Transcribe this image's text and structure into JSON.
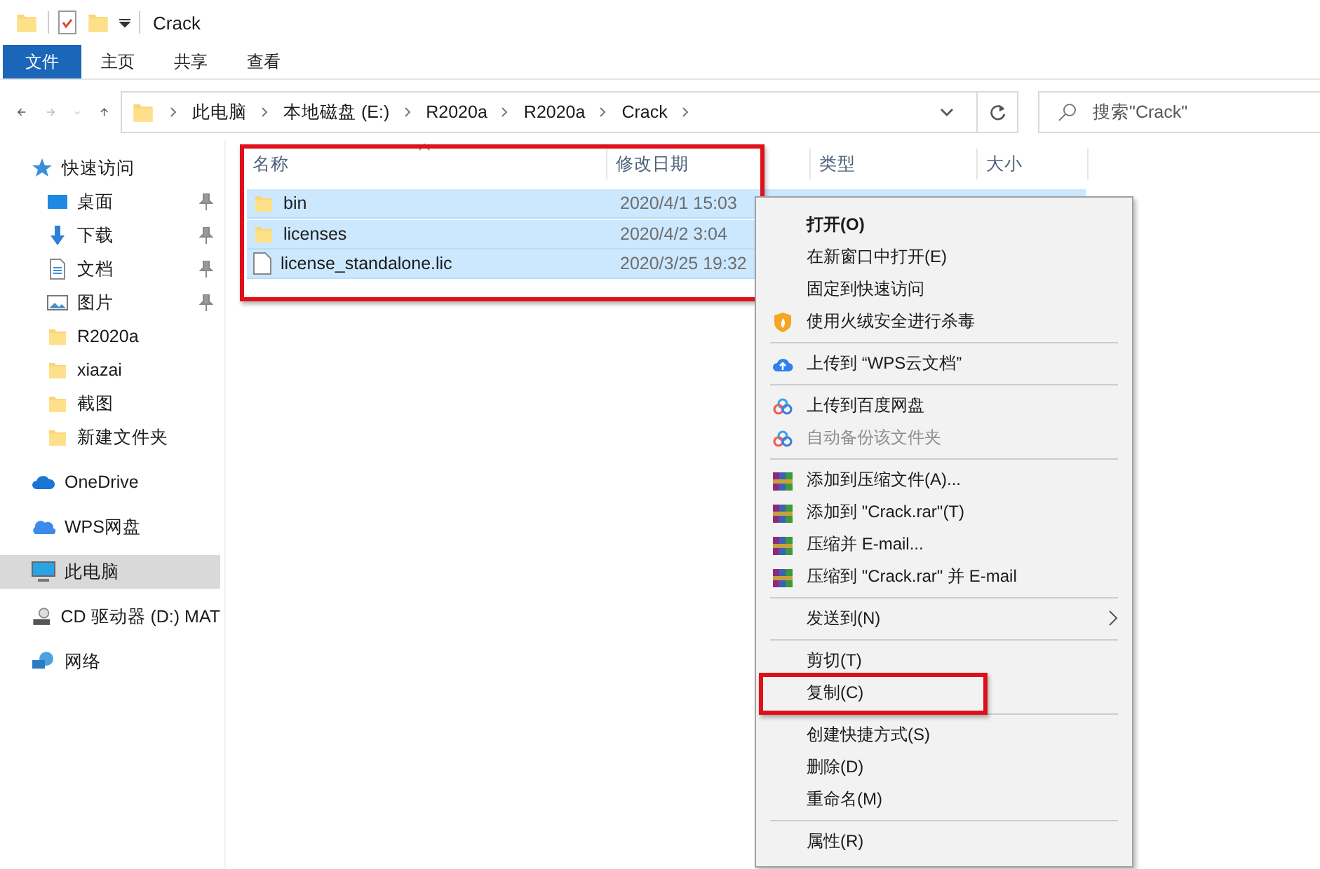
{
  "window": {
    "title": "Crack"
  },
  "ribbon_tabs": [
    {
      "label": "文件",
      "selected": true
    },
    {
      "label": "主页",
      "selected": false
    },
    {
      "label": "共享",
      "selected": false
    },
    {
      "label": "查看",
      "selected": false
    }
  ],
  "address_bar": {
    "breadcrumbs": [
      "此电脑",
      "本地磁盘 (E:)",
      "R2020a",
      "R2020a",
      "Crack"
    ]
  },
  "search": {
    "placeholder": "搜索\"Crack\""
  },
  "sidebar": {
    "items": [
      {
        "label": "快速访问",
        "kind": "star",
        "selected": false,
        "children": [
          {
            "label": "桌面",
            "kind": "desktop",
            "pinned": true,
            "selected": false
          },
          {
            "label": "下载",
            "kind": "download",
            "pinned": true,
            "selected": false
          },
          {
            "label": "文档",
            "kind": "document",
            "pinned": true,
            "selected": false
          },
          {
            "label": "图片",
            "kind": "picture",
            "pinned": true,
            "selected": false
          },
          {
            "label": "R2020a",
            "kind": "folder",
            "pinned": false,
            "selected": false
          },
          {
            "label": "xiazai",
            "kind": "folder",
            "pinned": false,
            "selected": false
          },
          {
            "label": "截图",
            "kind": "folder",
            "pinned": false,
            "selected": false
          },
          {
            "label": "新建文件夹",
            "kind": "folder",
            "pinned": false,
            "selected": false
          }
        ]
      },
      {
        "label": "OneDrive",
        "kind": "onedrive",
        "selected": false
      },
      {
        "label": "WPS网盘",
        "kind": "wps",
        "selected": false
      },
      {
        "label": "此电脑",
        "kind": "pc",
        "selected": true
      },
      {
        "label": "CD 驱动器 (D:) MAT",
        "kind": "cd",
        "selected": false
      },
      {
        "label": "网络",
        "kind": "network",
        "selected": false
      }
    ]
  },
  "file_list": {
    "columns": [
      "名称",
      "修改日期",
      "类型",
      "大小"
    ],
    "annotated": true,
    "rows": [
      {
        "name": "bin",
        "kind": "folder",
        "modified": "2020/4/1 15:03",
        "selected": true
      },
      {
        "name": "licenses",
        "kind": "folder",
        "modified": "2020/4/2 3:04",
        "selected": true
      },
      {
        "name": "license_standalone.lic",
        "kind": "file",
        "modified": "2020/3/25 19:32",
        "selected": true
      }
    ]
  },
  "context_menu": {
    "items": [
      {
        "kind": "item",
        "label": "打开(O)",
        "bold": true
      },
      {
        "kind": "item",
        "label": "在新窗口中打开(E)"
      },
      {
        "kind": "item",
        "label": "固定到快速访问"
      },
      {
        "kind": "antivirus",
        "label": "使用火绒安全进行杀毒"
      },
      {
        "kind": "separator"
      },
      {
        "kind": "upload",
        "label": "上传到 “WPS云文档”"
      },
      {
        "kind": "separator"
      },
      {
        "kind": "backup",
        "label": "上传到百度网盘"
      },
      {
        "kind": "backup",
        "label": "自动备份该文件夹",
        "disabled": true
      },
      {
        "kind": "separator"
      },
      {
        "kind": "archive",
        "label": "添加到压缩文件(A)..."
      },
      {
        "kind": "archive",
        "label": "添加到 \"Crack.rar\"(T)"
      },
      {
        "kind": "archive",
        "label": "压缩并 E-mail..."
      },
      {
        "kind": "archive",
        "label": "压缩到 \"Crack.rar\" 并 E-mail"
      },
      {
        "kind": "separator"
      },
      {
        "kind": "item",
        "label": "发送到(N)",
        "submenu": true
      },
      {
        "kind": "separator"
      },
      {
        "kind": "item",
        "label": "剪切(T)"
      },
      {
        "kind": "item",
        "label": "复制(C)",
        "annotated": true
      },
      {
        "kind": "separator"
      },
      {
        "kind": "item",
        "label": "创建快捷方式(S)"
      },
      {
        "kind": "item",
        "label": "删除(D)"
      },
      {
        "kind": "item",
        "label": "重命名(M)"
      },
      {
        "kind": "separator"
      },
      {
        "kind": "item",
        "label": "属性(R)"
      }
    ]
  }
}
